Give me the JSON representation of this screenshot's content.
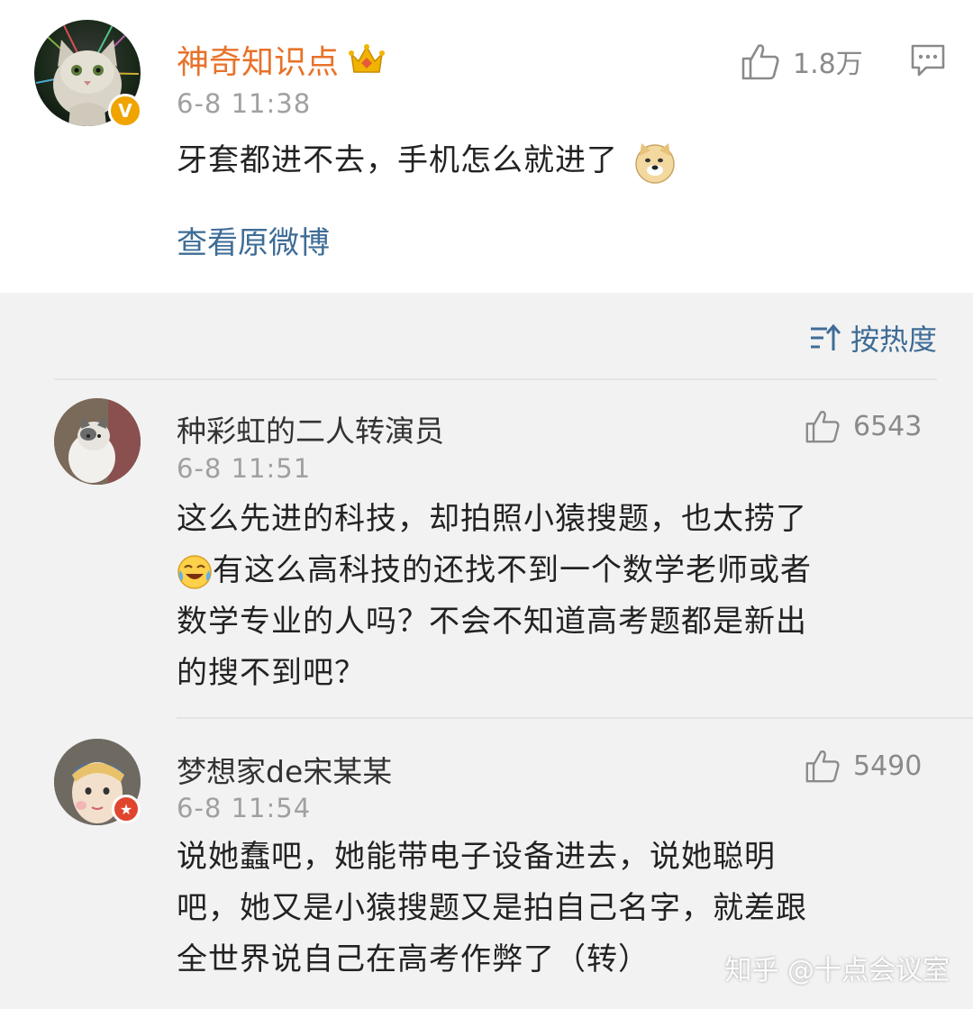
{
  "post": {
    "author": "神奇知识点",
    "timestamp": "6-8 11:38",
    "text": "牙套都进不去，手机怎么就进了",
    "likes": "1.8万",
    "view_original": "查看原微博",
    "author_color": "#e8722a"
  },
  "sort": {
    "label": "按热度"
  },
  "comments": [
    {
      "author": "种彩虹的二人转演员",
      "timestamp": "6-8 11:51",
      "likes": "6543",
      "text_line1": "这么先进的科技，却拍照小猿搜题，也太捞了",
      "text_line2": "有这么高科技的还找不到一个数学老师或者",
      "text_line3": "数学专业的人吗？不会不知道高考题都是新出",
      "text_line4": "的搜不到吧？"
    },
    {
      "author": "梦想家de宋某某",
      "timestamp": "6-8 11:54",
      "likes": "5490",
      "text_line1": "说她蠢吧，她能带电子设备进去，说她聪明",
      "text_line2": "吧，她又是小猿搜题又是拍自己名字，就差跟",
      "text_line3": "全世界说自己在高考作弊了（转）"
    }
  ],
  "watermark": "知乎 @十点会议室",
  "colors": {
    "link": "#3e6c96",
    "vip_gold": "#f0b400",
    "badge_red": "#e0462e"
  }
}
